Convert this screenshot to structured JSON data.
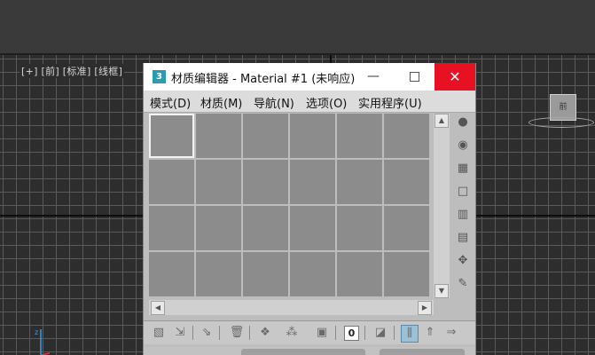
{
  "viewport": {
    "label_parts": [
      "[+]",
      "[前]",
      "[标准]",
      "[线框]"
    ],
    "nav_cube_label": "前"
  },
  "material_editor": {
    "app_icon_text": "3",
    "title": "材质编辑器 - Material #1 (未响应)",
    "minimize": "—",
    "maximize": "",
    "close": "✕",
    "menu": [
      "模式(D)",
      "材质(M)",
      "导航(N)",
      "选项(O)",
      "实用程序(U)"
    ],
    "slots": {
      "rows": 4,
      "cols": 6,
      "selected_index": 0
    },
    "scroll": {
      "up": "▲",
      "down": "▼",
      "left": "◀",
      "right": "▶"
    },
    "side_icons": [
      "sample-type-sphere-icon",
      "backlight-icon",
      "background-checker-icon",
      "sample-uv-tiling-icon",
      "video-color-check-icon",
      "make-preview-icon",
      "options-icon",
      "select-by-material-icon"
    ],
    "bottom_icons": [
      "get-material-icon",
      "put-to-scene-icon",
      "assign-to-selection-icon",
      "reset-map-icon",
      "make-copy-icon",
      "make-unique-icon",
      "put-to-library-icon",
      "material-id-channel-icon",
      "show-shaded-map-icon",
      "show-end-result-icon",
      "go-to-parent-icon",
      "go-forward-icon"
    ],
    "material_id_value": "0",
    "colors": {
      "close_button": "#e81123",
      "app_icon": "#2a9bb0",
      "slot": "#8c8c8c"
    }
  }
}
